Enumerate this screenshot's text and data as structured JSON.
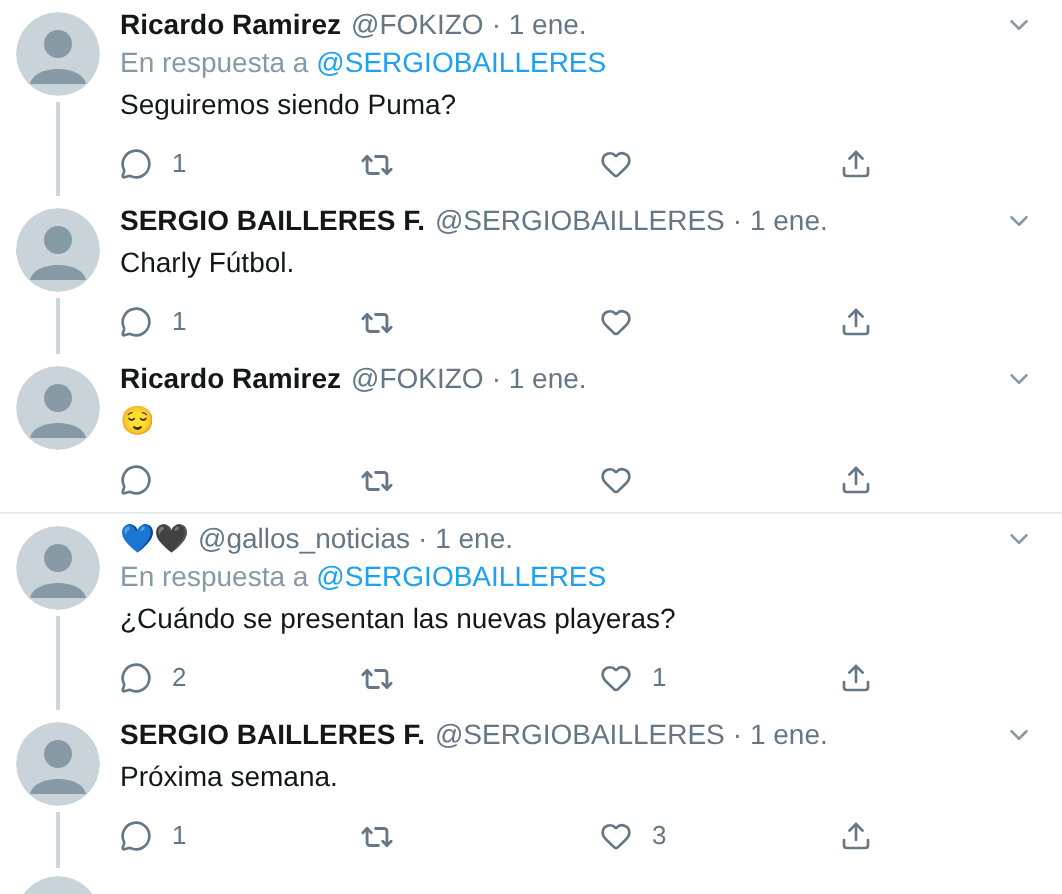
{
  "groups": [
    {
      "more_below": false,
      "tweets": [
        {
          "name": "Ricardo Ramirez",
          "handle": "@FOKIZO",
          "date": "· 1 ene.",
          "reply_prefix": "En respuesta a",
          "reply_mention": "@SERGIOBAILLERES",
          "text": "Seguiremos siendo Puma?",
          "replies": "1",
          "connected": true
        },
        {
          "name": "SERGIO BAILLERES F.",
          "handle": "@SERGIOBAILLERES",
          "date": "· 1 ene.",
          "text": "Charly Fútbol.",
          "replies": "1",
          "connected": true
        },
        {
          "name": "Ricardo Ramirez",
          "handle": "@FOKIZO",
          "date": "· 1 ene.",
          "text": "😌",
          "connected": false
        }
      ]
    },
    {
      "more_below": true,
      "tweets": [
        {
          "name": "💙🖤",
          "handle": "@gallos_noticias",
          "date": "· 1 ene.",
          "reply_prefix": "En respuesta a",
          "reply_mention": "@SERGIOBAILLERES",
          "text": "¿Cuándo se presentan las nuevas playeras?",
          "replies": "2",
          "likes": "1",
          "connected": true
        },
        {
          "name": "SERGIO BAILLERES F.",
          "handle": "@SERGIOBAILLERES",
          "date": "· 1 ene.",
          "text": "Próxima semana.",
          "replies": "1",
          "likes": "3",
          "connected": true
        }
      ]
    }
  ]
}
